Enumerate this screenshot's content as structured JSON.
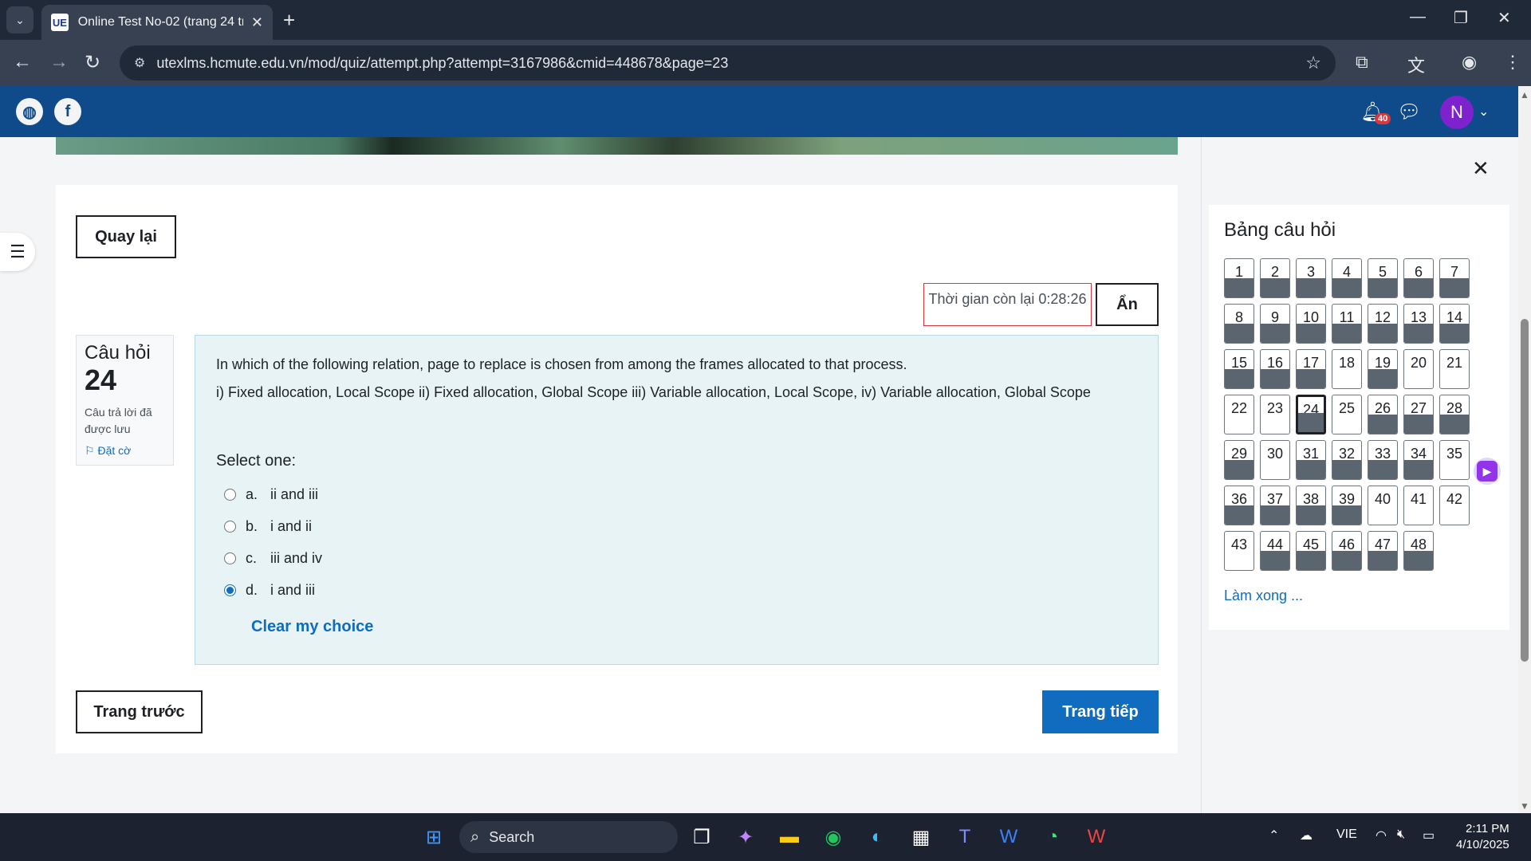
{
  "browser": {
    "tab_title": "Online Test No-02 (trang 24 trê",
    "favicon_text": "UE",
    "url": "utexlms.hcmute.edu.vn/mod/quiz/attempt.php?attempt=3167986&cmid=448678&page=23"
  },
  "site": {
    "notification_count": "40",
    "avatar_initial": "N"
  },
  "quiz": {
    "back_label": "Quay lại",
    "timer_text": "Thời gian còn lại 0:28:26",
    "hide_label": "Ẩn",
    "question_label": "Câu hỏi",
    "question_number": "24",
    "question_state": "Câu trả lời đã được lưu",
    "flag_label": "Đặt cờ",
    "question_line1": "In which of the following relation, page to replace is chosen from among the frames allocated to that process.",
    "question_line2": "i) Fixed allocation, Local Scope  ii) Fixed allocation, Global Scope iii) Variable allocation, Local Scope, iv) Variable allocation, Global Scope",
    "select_prompt": "Select one:",
    "options": [
      {
        "letter": "a.",
        "text": "ii  and iii",
        "checked": false
      },
      {
        "letter": "b.",
        "text": "i and ii",
        "checked": false
      },
      {
        "letter": "c.",
        "text": "iii and iv",
        "checked": false
      },
      {
        "letter": "d.",
        "text": "i and iii",
        "checked": true
      }
    ],
    "clear_label": "Clear my choice",
    "prev_label": "Trang trước",
    "next_label": "Trang tiếp"
  },
  "navigation": {
    "title": "Bảng câu hỏi",
    "current": 24,
    "answered": [
      1,
      2,
      3,
      4,
      5,
      6,
      7,
      8,
      9,
      10,
      11,
      12,
      13,
      14,
      15,
      16,
      17,
      19,
      24,
      26,
      27,
      28,
      29,
      31,
      32,
      33,
      34,
      36,
      37,
      38,
      39,
      44,
      45,
      46,
      47,
      48
    ],
    "total": 48,
    "finish_label": "Làm xong ..."
  },
  "taskbar": {
    "search_label": "Search",
    "language": "VIE",
    "time": "2:11 PM",
    "date": "4/10/2025"
  }
}
